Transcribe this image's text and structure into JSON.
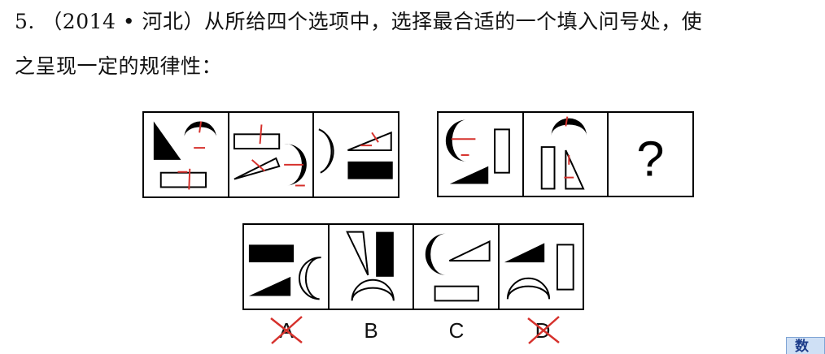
{
  "question": {
    "line1": "5. （2014 • 河北）从所给四个选项中，选择最合适的一个填入问号处，使",
    "line2": "之呈现一定的规律性："
  },
  "question_mark": "?",
  "options": [
    {
      "label": "A",
      "crossed": true
    },
    {
      "label": "B",
      "crossed": false
    },
    {
      "label": "C",
      "crossed": false
    },
    {
      "label": "D",
      "crossed": true
    }
  ],
  "annotation_color": "#d6312c",
  "corner_badge": "数"
}
